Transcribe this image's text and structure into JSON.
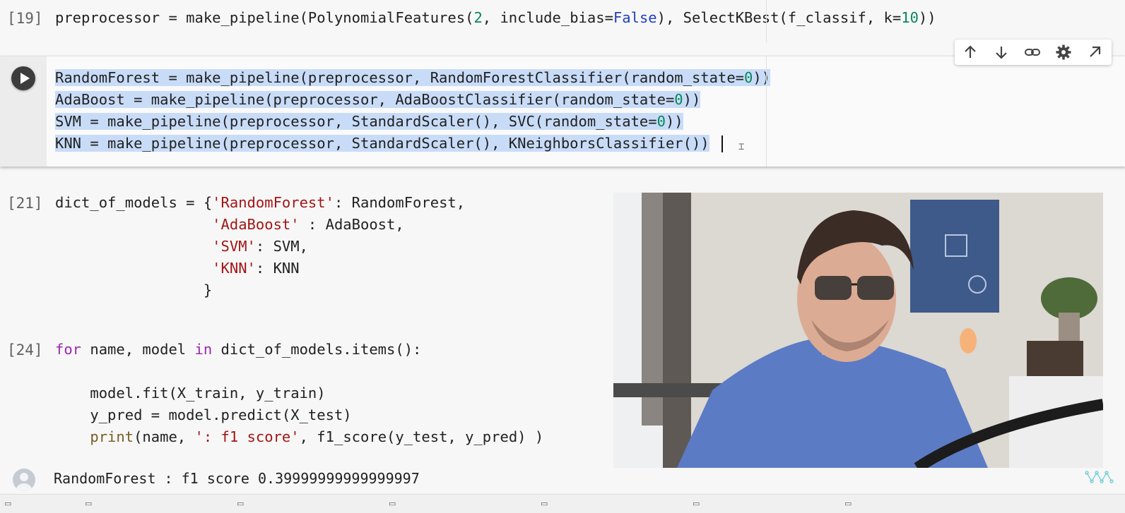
{
  "cells": [
    {
      "prompt": "[19]",
      "lines": [
        [
          {
            "t": "preprocessor ",
            "c": ""
          },
          {
            "t": "=",
            "c": "eq"
          },
          {
            "t": " make_pipeline(PolynomialFeatures(",
            "c": ""
          },
          {
            "t": "2",
            "c": "num"
          },
          {
            "t": ", include_bias",
            "c": ""
          },
          {
            "t": "=",
            "c": "eq"
          },
          {
            "t": "False",
            "c": "bool"
          },
          {
            "t": "), SelectKBest(f_classif, k",
            "c": ""
          },
          {
            "t": "=",
            "c": "eq"
          },
          {
            "t": "10",
            "c": "num"
          },
          {
            "t": "))",
            "c": ""
          }
        ]
      ]
    },
    {
      "prompt": "",
      "lines": [
        [
          {
            "t": "RandomForest = make_pipeline(preprocessor, RandomForestClassifier(random_state=",
            "c": "sel"
          },
          {
            "t": "0",
            "c": "sel num"
          },
          {
            "t": "))",
            "c": "sel"
          }
        ],
        [
          {
            "t": "AdaBoost = make_pipeline(preprocessor, AdaBoostClassifier(random_state=",
            "c": "sel"
          },
          {
            "t": "0",
            "c": "sel num"
          },
          {
            "t": "))",
            "c": "sel"
          }
        ],
        [
          {
            "t": "SVM = make_pipeline(preprocessor, StandardScaler(), SVC(random_state=",
            "c": "sel"
          },
          {
            "t": "0",
            "c": "sel num"
          },
          {
            "t": "))",
            "c": "sel"
          }
        ],
        [
          {
            "t": "KNN = make_pipeline(preprocessor, StandardScaler(), KNeighborsClassifier())",
            "c": "sel"
          }
        ]
      ]
    },
    {
      "prompt": "[21]",
      "lines": [
        [
          {
            "t": "dict_of_models = {",
            "c": ""
          },
          {
            "t": "'RandomForest'",
            "c": "str"
          },
          {
            "t": ": RandomForest,",
            "c": ""
          }
        ],
        [
          {
            "t": "                  ",
            "c": ""
          },
          {
            "t": "'AdaBoost'",
            "c": "str"
          },
          {
            "t": " : AdaBoost,",
            "c": ""
          }
        ],
        [
          {
            "t": "                  ",
            "c": ""
          },
          {
            "t": "'SVM'",
            "c": "str"
          },
          {
            "t": ": SVM,",
            "c": ""
          }
        ],
        [
          {
            "t": "                  ",
            "c": ""
          },
          {
            "t": "'KNN'",
            "c": "str"
          },
          {
            "t": ": KNN",
            "c": ""
          }
        ],
        [
          {
            "t": "                 }",
            "c": ""
          }
        ]
      ]
    },
    {
      "prompt": "[24]",
      "lines": [
        [
          {
            "t": "for",
            "c": "kw"
          },
          {
            "t": " name, model ",
            "c": ""
          },
          {
            "t": "in",
            "c": "kw"
          },
          {
            "t": " dict_of_models.items():",
            "c": ""
          }
        ],
        [
          {
            "t": "",
            "c": ""
          }
        ],
        [
          {
            "t": "    model.fit(X_train, y_train)",
            "c": ""
          }
        ],
        [
          {
            "t": "    y_pred = model.predict(X_test)",
            "c": ""
          }
        ],
        [
          {
            "t": "    ",
            "c": ""
          },
          {
            "t": "print",
            "c": "kwp"
          },
          {
            "t": "(name, ",
            "c": ""
          },
          {
            "t": "': f1 score'",
            "c": "str"
          },
          {
            "t": ", f1_score(y_test, y_pred) )",
            "c": ""
          }
        ]
      ]
    }
  ],
  "output": {
    "text": "RandomForest : f1 score 0.39999999999999997"
  },
  "toolbar": {
    "icons": [
      "arrow-up-icon",
      "arrow-down-icon",
      "link-icon",
      "gear-icon",
      "open-external-icon"
    ]
  },
  "colors": {
    "selection": "#c8dcf8",
    "keyword": "#9c27b0",
    "number": "#098658",
    "string": "#a31515",
    "bool": "#1f3fbf"
  }
}
